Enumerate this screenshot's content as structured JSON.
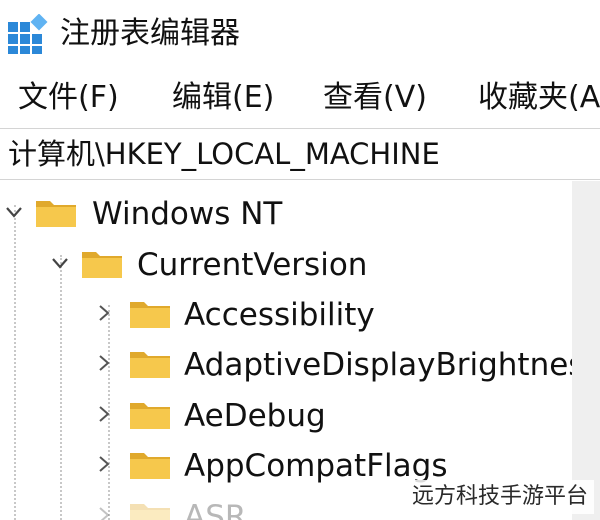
{
  "window": {
    "title": "注册表编辑器",
    "icon": "registry-editor-icon"
  },
  "menubar": {
    "items": [
      "文件(F)",
      "编辑(E)",
      "查看(V)",
      "收藏夹(A)"
    ]
  },
  "address": {
    "path": "计算机\\HKEY_LOCAL_MACHINE"
  },
  "tree": {
    "nodes": [
      {
        "label": "Windows NT",
        "state": "expanded"
      },
      {
        "label": "CurrentVersion",
        "state": "expanded"
      },
      {
        "label": "Accessibility",
        "state": "collapsed"
      },
      {
        "label": "AdaptiveDisplayBrightness",
        "state": "collapsed"
      },
      {
        "label": "AeDebug",
        "state": "collapsed"
      },
      {
        "label": "AppCompatFlags",
        "state": "collapsed"
      },
      {
        "label": "ASR",
        "state": "collapsed"
      }
    ]
  },
  "watermark": {
    "text": "远方科技手游平台"
  },
  "colors": {
    "folder": "#f6c84c",
    "folder_dark": "#e0a92c",
    "icon_blue": "#2b88d8",
    "scroll_track": "#efefef"
  }
}
